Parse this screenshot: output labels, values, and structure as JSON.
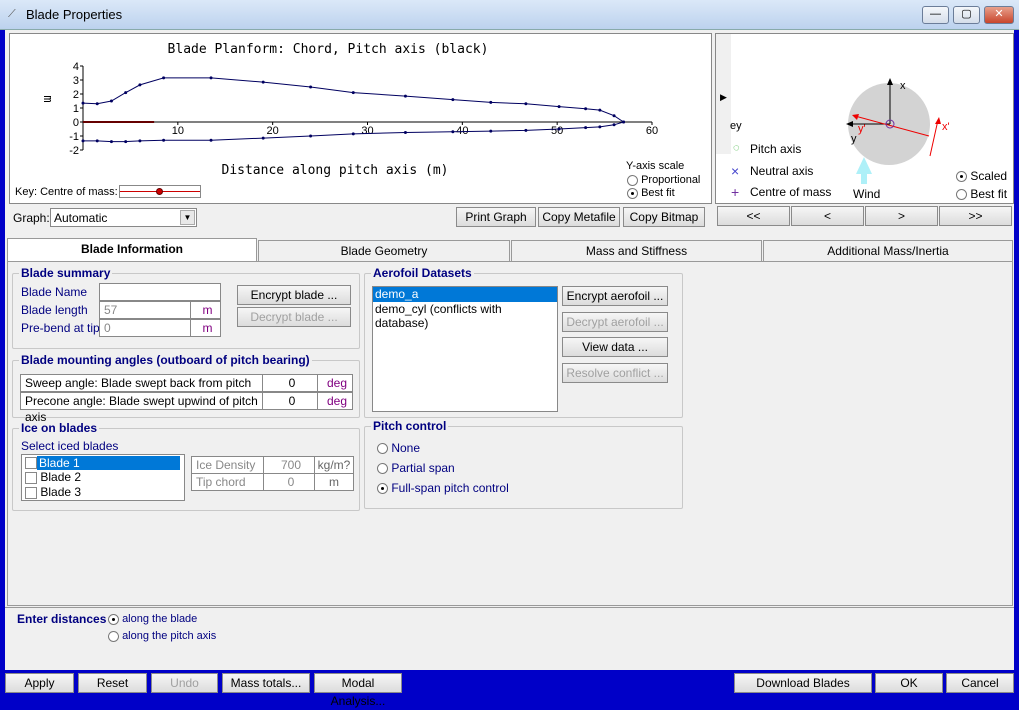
{
  "window": {
    "title": "Blade Properties",
    "controls": [
      "—",
      "▢",
      "✕"
    ]
  },
  "graph": {
    "label": "Graph:",
    "selected": "Automatic",
    "buttons": [
      "Print Graph",
      "Copy Metafile",
      "Copy Bitmap"
    ],
    "key_label": "Key: Centre of mass:",
    "yscale": {
      "label": "Y-axis scale",
      "options": [
        "Proportional",
        "Best fit"
      ],
      "selected": "Best fit"
    }
  },
  "chart_data": {
    "type": "line",
    "title": "Blade Planform: Chord, Pitch axis (black)",
    "xlabel": "Distance along pitch axis (m)",
    "ylabel": "m",
    "xlim": [
      0,
      60
    ],
    "ylim": [
      -2,
      4
    ],
    "xticks": [
      10,
      20,
      30,
      40,
      50,
      60
    ],
    "yticks": [
      4,
      3,
      2,
      1,
      0,
      -1,
      -2
    ],
    "leading_edge": {
      "x": [
        0,
        1.5,
        3,
        4.5,
        6,
        8.5,
        13.5,
        19,
        24,
        28.5,
        34,
        39,
        43,
        46.7,
        50.2,
        53,
        54.5,
        56,
        57
      ],
      "y": [
        1.35,
        1.3,
        1.5,
        2.1,
        2.65,
        3.15,
        3.15,
        2.85,
        2.5,
        2.1,
        1.85,
        1.6,
        1.4,
        1.3,
        1.1,
        0.95,
        0.85,
        0.45,
        0
      ]
    },
    "trailing_edge": {
      "x": [
        0,
        1.5,
        3,
        4.5,
        6,
        8.5,
        13.5,
        19,
        24,
        28.5,
        34,
        39,
        43,
        46.7,
        50.2,
        53,
        54.5,
        56,
        57
      ],
      "y": [
        -1.35,
        -1.35,
        -1.4,
        -1.4,
        -1.35,
        -1.3,
        -1.3,
        -1.15,
        -1.0,
        -0.85,
        -0.75,
        -0.7,
        -0.65,
        -0.6,
        -0.5,
        -0.4,
        -0.35,
        -0.2,
        0
      ]
    },
    "pitch_axis": {
      "x": [
        0,
        57
      ],
      "y": [
        0,
        0
      ]
    },
    "centre_of_mass": {
      "x": [
        0,
        7.5
      ],
      "y": [
        0,
        0
      ]
    },
    "colors": {
      "chord": "#000060",
      "pitch_axis": "#000000",
      "centre_of_mass": "#cc0000"
    }
  },
  "section": {
    "key_label": "ey",
    "legend": [
      "Pitch axis",
      "Neutral axis",
      "Centre of mass"
    ],
    "axis_labels": {
      "x": "x",
      "y": "y",
      "xp": "x'",
      "yp": "y'"
    },
    "wind": "Wind",
    "scale": {
      "options": [
        "Scaled",
        "Best fit"
      ],
      "selected": "Scaled"
    },
    "nav": [
      "<<",
      "<",
      ">",
      ">>"
    ]
  },
  "tabs": [
    {
      "label": "Blade Information",
      "active": true
    },
    {
      "label": "Blade Geometry"
    },
    {
      "label": "Mass and Stiffness"
    },
    {
      "label": "Additional Mass/Inertia"
    }
  ],
  "summary": {
    "title": "Blade summary",
    "name_label": "Blade Name",
    "name_value": "",
    "length_label": "Blade length",
    "length_value": "57",
    "length_unit": "m",
    "prebend_label": "Pre-bend at tip",
    "prebend_value": "0",
    "prebend_unit": "m",
    "encrypt": "Encrypt blade ...",
    "decrypt": "Decrypt blade ..."
  },
  "mounting": {
    "title": "Blade mounting angles (outboard of pitch bearing)",
    "rows": [
      {
        "label": "Sweep angle: Blade swept back from pitch axis",
        "value": "0",
        "unit": "deg"
      },
      {
        "label": "Precone angle: Blade swept upwind of pitch axis",
        "value": "0",
        "unit": "deg"
      }
    ]
  },
  "ice": {
    "title": "Ice on blades",
    "select_label": "Select iced blades",
    "blades": [
      "Blade 1",
      "Blade 2",
      "Blade 3"
    ],
    "selected": "Blade 1",
    "density_label": "Ice Density",
    "density_value": "700",
    "density_unit": "kg/m?",
    "tip_label": "Tip chord",
    "tip_value": "0",
    "tip_unit": "m"
  },
  "aerofoil": {
    "title": "Aerofoil Datasets",
    "items": [
      "demo_a",
      "demo_cyl (conflicts with database)"
    ],
    "selected": "demo_a",
    "buttons": [
      "Encrypt aerofoil ...",
      "Decrypt aerofoil ...",
      "View data ...",
      "Resolve conflict ..."
    ]
  },
  "pitch": {
    "title": "Pitch control",
    "options": [
      "None",
      "Partial span",
      "Full-span pitch control"
    ],
    "selected": "Full-span pitch control"
  },
  "distances": {
    "label": "Enter distances",
    "options": [
      "along the blade",
      "along the pitch axis"
    ],
    "selected": "along the blade"
  },
  "footer": {
    "left": [
      "Apply",
      "Reset",
      "Undo",
      "Mass totals...",
      "Modal Analysis..."
    ],
    "right": [
      "Download Blades",
      "OK",
      "Cancel"
    ]
  },
  "colors": {
    "frame": "#0000c8",
    "label": "#000080",
    "unit": "#800080",
    "selection": "#0078d7"
  }
}
